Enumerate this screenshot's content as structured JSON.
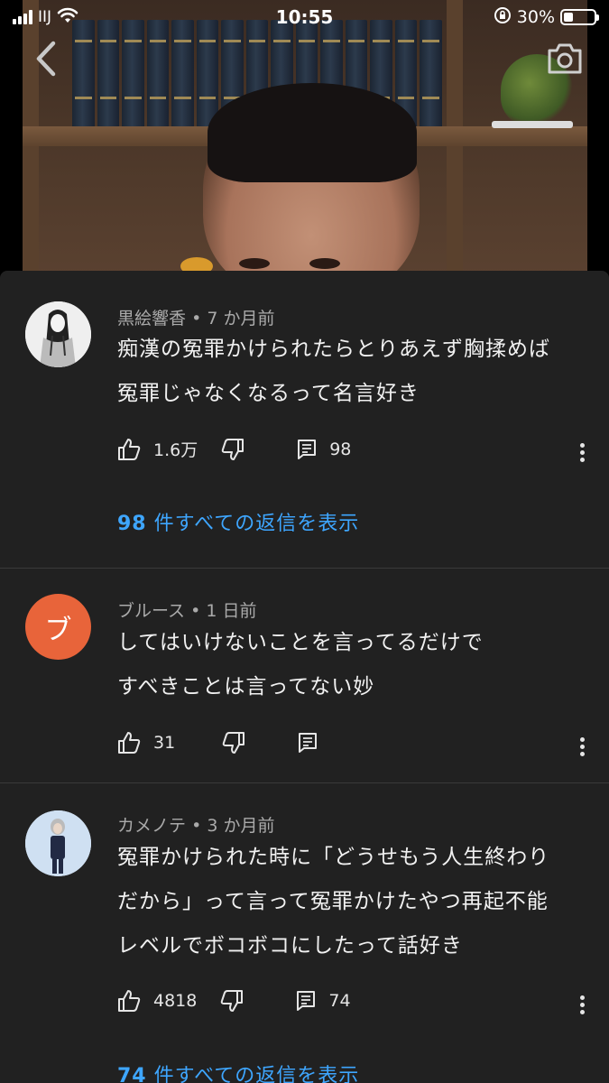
{
  "status_bar": {
    "carrier": "IIJ",
    "time": "10:55",
    "battery_percent": "30%",
    "battery_level": 0.3
  },
  "video": {
    "back_icon": "chevron-left-icon",
    "camera_icon": "camera-icon"
  },
  "comments": [
    {
      "author": "黒絵響香",
      "time": "7 か月前",
      "lines": [
        "痴漢の冤罪かけられたらとりあえず胸揉めば",
        "冤罪じゃなくなるって名言好き"
      ],
      "likes": "1.6万",
      "reply_count": "98",
      "replies_link_count": "98",
      "replies_link_text": "件すべての返信を表示",
      "avatar_letter": ""
    },
    {
      "author": "ブルース",
      "time": "1 日前",
      "lines": [
        "してはいけないことを言ってるだけで",
        "すべきことは言ってない妙"
      ],
      "likes": "31",
      "reply_count": "",
      "avatar_letter": "ブ",
      "avatar_color": "#e8643a"
    },
    {
      "author": "カメノテ",
      "time": "3 か月前",
      "lines": [
        "冤罪かけられた時に「どうせもう人生終わり",
        "だから」って言って冤罪かけたやつ再起不能",
        "レベルでボコボコにしたって話好き"
      ],
      "likes": "4818",
      "reply_count": "74",
      "replies_link_count": "74",
      "replies_link_text": "件すべての返信を表示",
      "avatar_letter": ""
    }
  ],
  "meta_separator": "•"
}
